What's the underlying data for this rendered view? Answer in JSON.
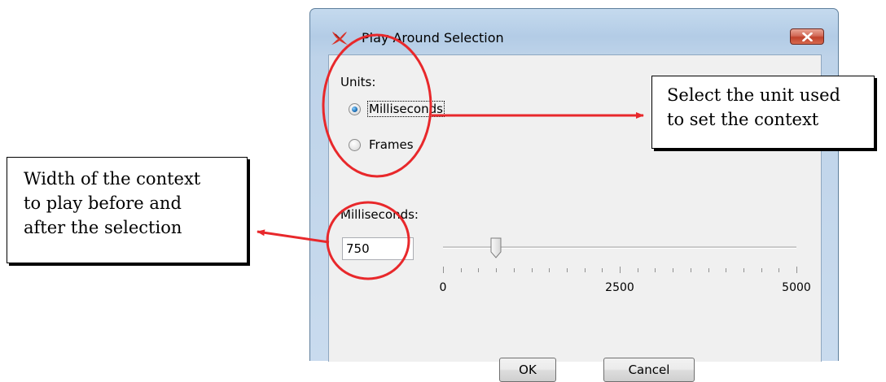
{
  "window": {
    "title": "Play Around Selection"
  },
  "units": {
    "label": "Units:",
    "options": [
      {
        "label": "Milliseconds",
        "selected": true
      },
      {
        "label": "Frames",
        "selected": false
      }
    ]
  },
  "milliseconds": {
    "label": "Milliseconds:",
    "value": "750"
  },
  "slider": {
    "min": 0,
    "max": 5000,
    "value": 750,
    "tick_labels": [
      "0",
      "2500",
      "5000"
    ]
  },
  "buttons": {
    "ok": "OK",
    "cancel": "Cancel"
  },
  "annotations": {
    "unit": [
      "Select the unit used",
      "to set the context"
    ],
    "width": [
      "Width of the context",
      "to play before and",
      "after the selection"
    ],
    "color": "#e8282b"
  },
  "colors": {
    "title_bar": "#b9d1ea",
    "close_button": "#c94c35",
    "radio_selected": "#1e6fb5",
    "client_background": "#f0f0f0"
  }
}
